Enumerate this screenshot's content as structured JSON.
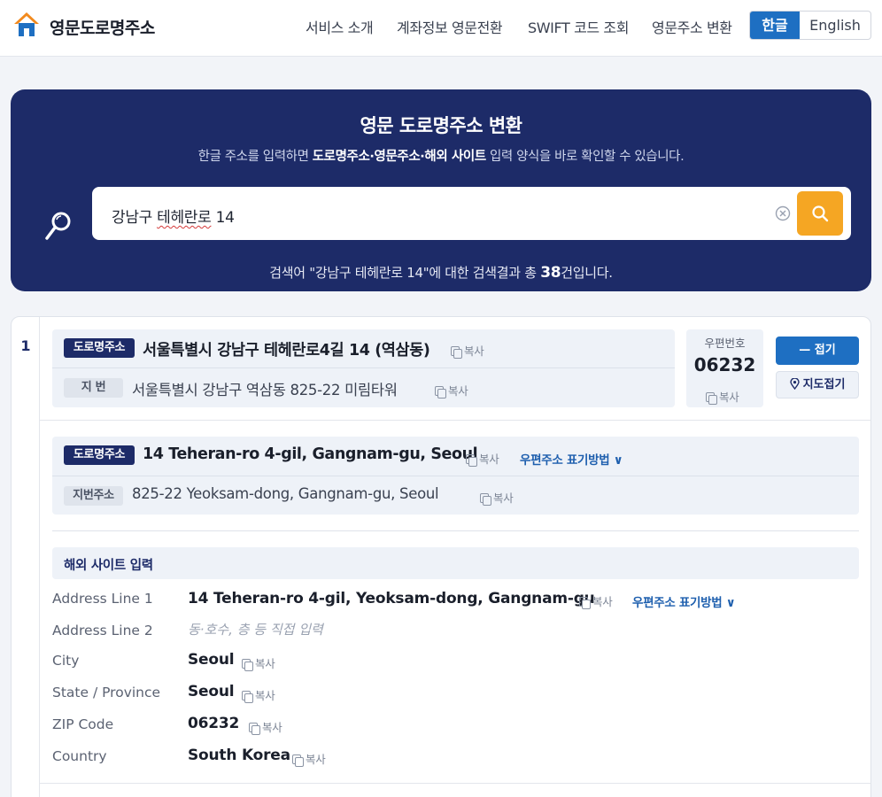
{
  "header": {
    "brand": "영문도로명주소",
    "nav": [
      "서비스 소개",
      "계좌정보 영문전환",
      "SWIFT 코드 조회",
      "영문주소 변환"
    ],
    "lang_ko": "한글",
    "lang_en": "English"
  },
  "hero": {
    "title": "영문 도로명주소 변환",
    "sub_pre": "한글 주소를 입력하면 ",
    "sub_bold": "도로명주소·영문주소·해외 사이트",
    "sub_post": " 입력 양식을 바로 확인할 수 있습니다.",
    "query_part1": "강남구 ",
    "query_part2": "테헤란로",
    "query_part3": " 14",
    "result_pre": "검색어 \"강남구 테헤란로 14\"에 대한 검색결과 총 ",
    "result_count": "38",
    "result_post": "건입니다."
  },
  "result": {
    "index": "1",
    "road_tag": "도로명주소",
    "road_kr": "서울특별시 강남구 테헤란로4길 14 (역삼동)",
    "jibun_tag": "지 번",
    "jibun_kr": "서울특별시 강남구 역삼동 825-22 미림타워",
    "copy": "복사",
    "zip_label": "우편번호",
    "zip": "06232",
    "fold_btn": "— 접기",
    "map_btn": "지도접기",
    "road_en_tag": "도로명주소",
    "road_en": "14 Teheran-ro 4-gil, Gangnam-gu, Seoul",
    "format_link": "우편주소 표기방법 ∨",
    "jibun_en_tag": "지번주소",
    "jibun_en": "825-22 Yeoksam-dong, Gangnam-gu, Seoul"
  },
  "overseas": {
    "title": "해외 사이트 입력",
    "fields": [
      {
        "label": "Address Line 1",
        "value": "14 Teheran-ro 4-gil, Yeoksam-dong, Gangnam-gu"
      },
      {
        "label": "Address Line 2",
        "value": "동·호수, 층 등 직접 입력"
      },
      {
        "label": "City",
        "value": "Seoul"
      },
      {
        "label": "State / Province",
        "value": "Seoul"
      },
      {
        "label": "ZIP Code",
        "value": "06232"
      },
      {
        "label": "Country",
        "value": "South Korea"
      }
    ]
  },
  "colors": {
    "navy": "#1d2b68",
    "blue": "#1e6fc2",
    "orange": "#f5a623"
  }
}
